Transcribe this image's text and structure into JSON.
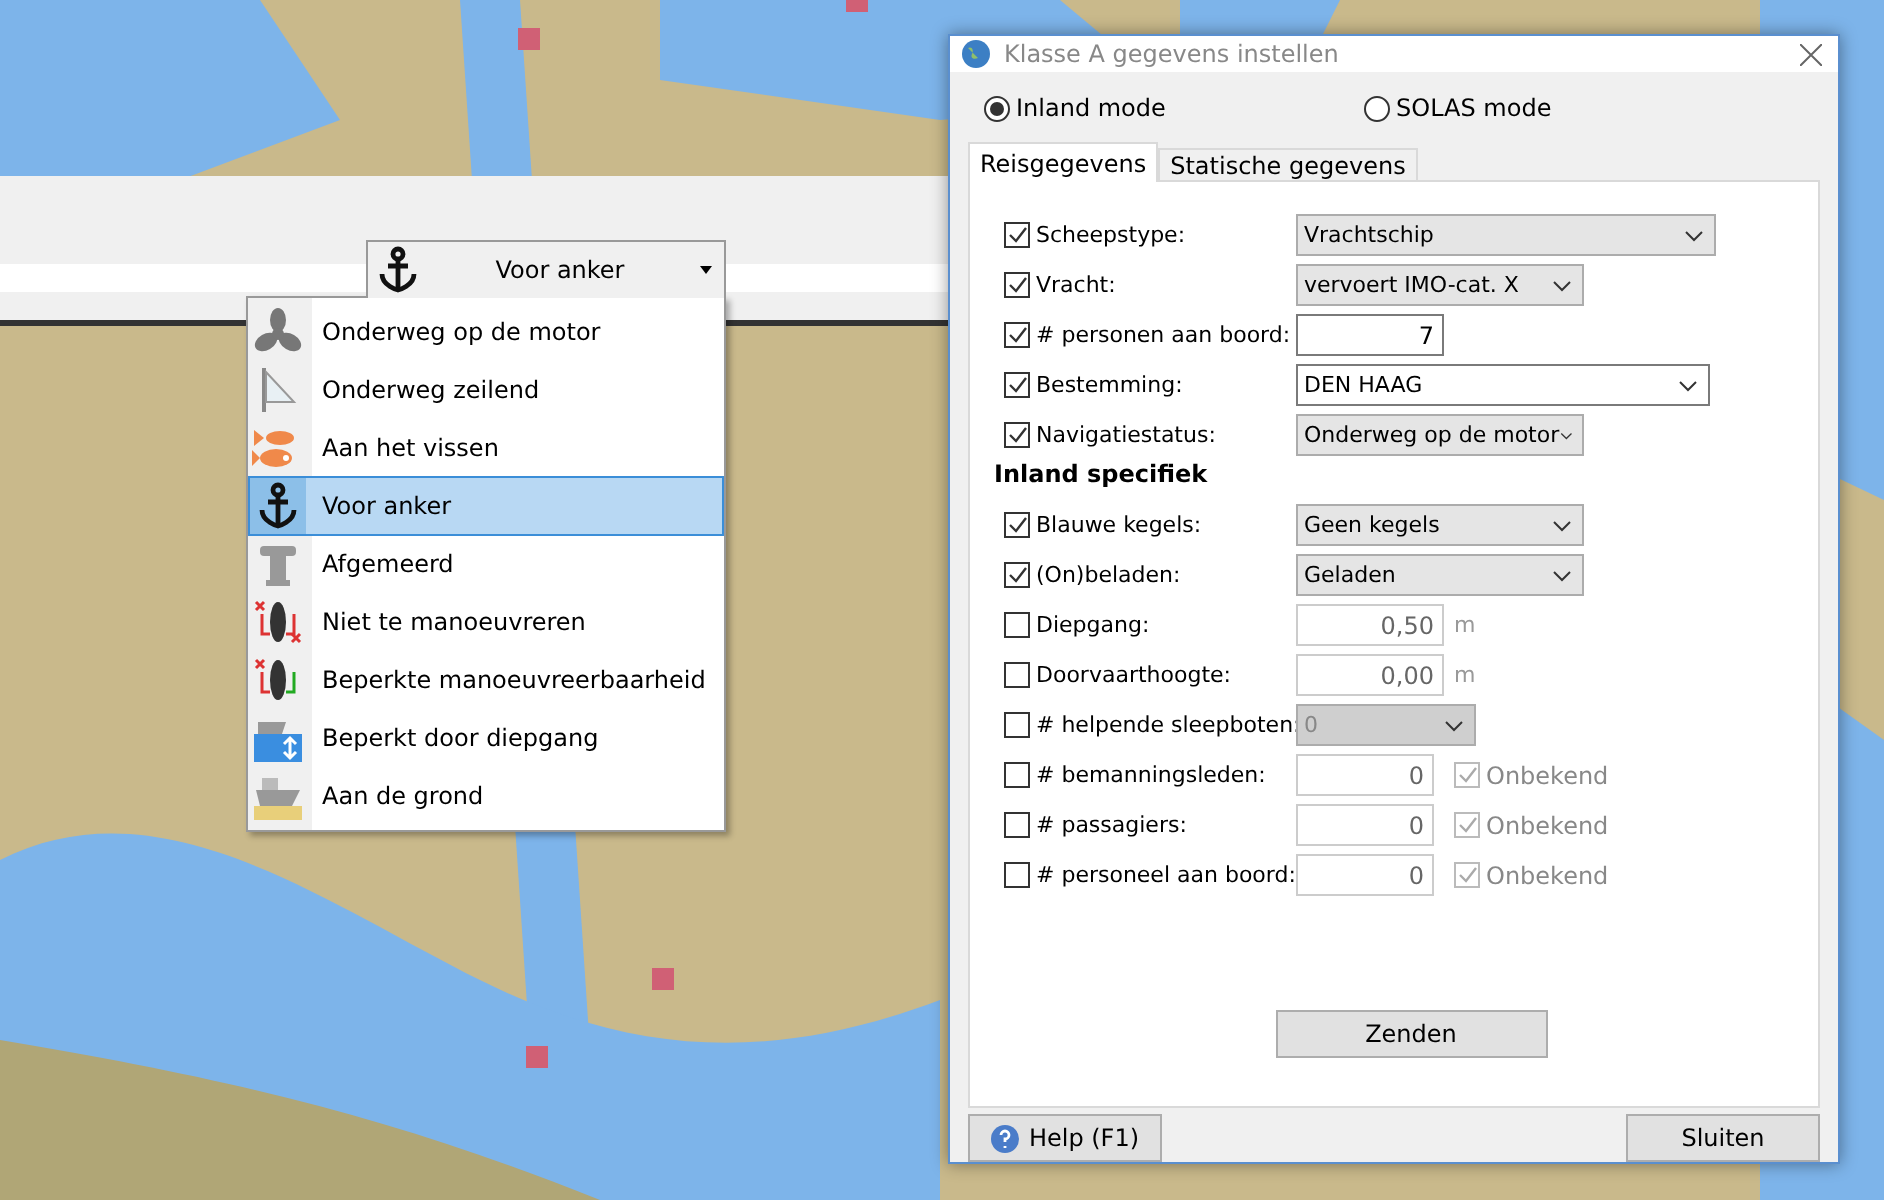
{
  "toolbar": {
    "dropdown": {
      "value": "Voor anker"
    }
  },
  "menu": {
    "items": [
      {
        "label": "Onderweg op de motor",
        "selected": false
      },
      {
        "label": "Onderweg zeilend",
        "selected": false
      },
      {
        "label": "Aan het vissen",
        "selected": false
      },
      {
        "label": "Voor anker",
        "selected": true
      },
      {
        "label": "Afgemeerd",
        "selected": false
      },
      {
        "label": "Niet te manoeuvreren",
        "selected": false
      },
      {
        "label": "Beperkte manoeuvreerbaarheid",
        "selected": false
      },
      {
        "label": "Beperkt door diepgang",
        "selected": false
      },
      {
        "label": "Aan de grond",
        "selected": false
      }
    ]
  },
  "dialog": {
    "title": "Klasse A gegevens instellen",
    "modes": [
      {
        "label": "Inland mode",
        "selected": true
      },
      {
        "label": "SOLAS mode",
        "selected": false
      }
    ],
    "tabs": [
      {
        "label": "Reisgegevens",
        "selected": true
      },
      {
        "label": "Statische gegevens",
        "selected": false
      }
    ],
    "rows": [
      {
        "kind": "combo-wide",
        "label": "Scheepstype:",
        "checked": true,
        "value": "Vrachtschip"
      },
      {
        "kind": "combo",
        "label": "Vracht:",
        "checked": true,
        "value": "vervoert IMO-cat. X"
      },
      {
        "kind": "input",
        "label": "# personen aan boord:",
        "checked": true,
        "value": "7"
      },
      {
        "kind": "edit-combo",
        "label": "Bestemming:",
        "checked": true,
        "value": "DEN HAAG"
      },
      {
        "kind": "combo",
        "label": "Navigatiestatus:",
        "checked": true,
        "value": "Onderweg op de motor"
      }
    ],
    "section": "Inland specifiek",
    "inland_rows": [
      {
        "kind": "combo",
        "label": "Blauwe kegels:",
        "checked": true,
        "value": "Geen kegels"
      },
      {
        "kind": "combo",
        "label": "(On)beladen:",
        "checked": true,
        "value": "Geladen"
      },
      {
        "kind": "input",
        "label": "Diepgang:",
        "checked": false,
        "value": "0,50",
        "unit": "m"
      },
      {
        "kind": "input",
        "label": "Doorvaarthoogte:",
        "checked": false,
        "value": "0,00",
        "unit": "m"
      },
      {
        "kind": "combo-disabled",
        "label": "# helpende sleepboten:",
        "checked": false,
        "value": "0"
      },
      {
        "kind": "count",
        "label": "# bemanningsleden:",
        "checked": false,
        "value": "0",
        "unknown": {
          "label": "Onbekend",
          "checked": true
        }
      },
      {
        "kind": "count",
        "label": "# passagiers:",
        "checked": false,
        "value": "0",
        "unknown": {
          "label": "Onbekend",
          "checked": true
        }
      },
      {
        "kind": "count",
        "label": "# personeel aan boord:",
        "checked": false,
        "value": "0",
        "unknown": {
          "label": "Onbekend",
          "checked": true
        }
      }
    ],
    "send_button": "Zenden",
    "help_button": "Help (F1)",
    "close_button": "Sluiten"
  }
}
